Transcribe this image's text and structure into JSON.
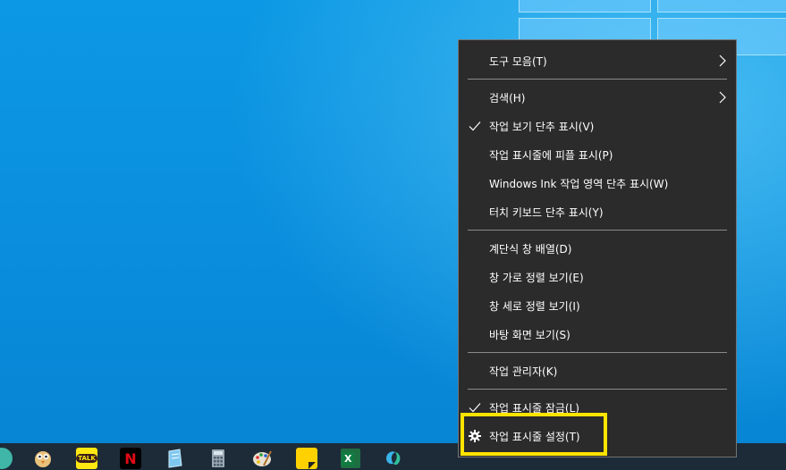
{
  "context_menu": {
    "items": [
      {
        "label": "도구 모음(T)",
        "submenu": true,
        "checked": false
      },
      {
        "label": "검색(H)",
        "submenu": true,
        "checked": false
      },
      {
        "label": "작업 보기 단추 표시(V)",
        "submenu": false,
        "checked": true
      },
      {
        "label": "작업 표시줄에 피플 표시(P)",
        "submenu": false,
        "checked": false
      },
      {
        "label": "Windows Ink 작업 영역 단추 표시(W)",
        "submenu": false,
        "checked": false
      },
      {
        "label": "터치 키보드 단추 표시(Y)",
        "submenu": false,
        "checked": false
      },
      {
        "label": "계단식 창 배열(D)",
        "submenu": false,
        "checked": false
      },
      {
        "label": "창 가로 정렬 보기(E)",
        "submenu": false,
        "checked": false
      },
      {
        "label": "창 세로 정렬 보기(I)",
        "submenu": false,
        "checked": false
      },
      {
        "label": "바탕 화면 보기(S)",
        "submenu": false,
        "checked": false
      },
      {
        "label": "작업 관리자(K)",
        "submenu": false,
        "checked": false
      },
      {
        "label": "작업 표시줄 잠금(L)",
        "submenu": false,
        "checked": true
      },
      {
        "label": "작업 표시줄 설정(T)",
        "submenu": false,
        "checked": false,
        "icon": "gear-icon"
      }
    ]
  },
  "taskbar": {
    "icons": [
      "app-icon",
      "owl-app-icon",
      "kakaotalk-icon",
      "netflix-icon",
      "notepad-icon",
      "calculator-icon",
      "paint-icon",
      "sticky-notes-icon",
      "excel-icon",
      "app-icon"
    ],
    "kakaotalk_text": "TALK",
    "netflix_text": "N",
    "excel_text": "X"
  },
  "colors": {
    "menu_background": "#2b2b2b",
    "highlight": "#ffe400",
    "desktop": "#0a8fde",
    "taskbar": "#1d2b38"
  }
}
